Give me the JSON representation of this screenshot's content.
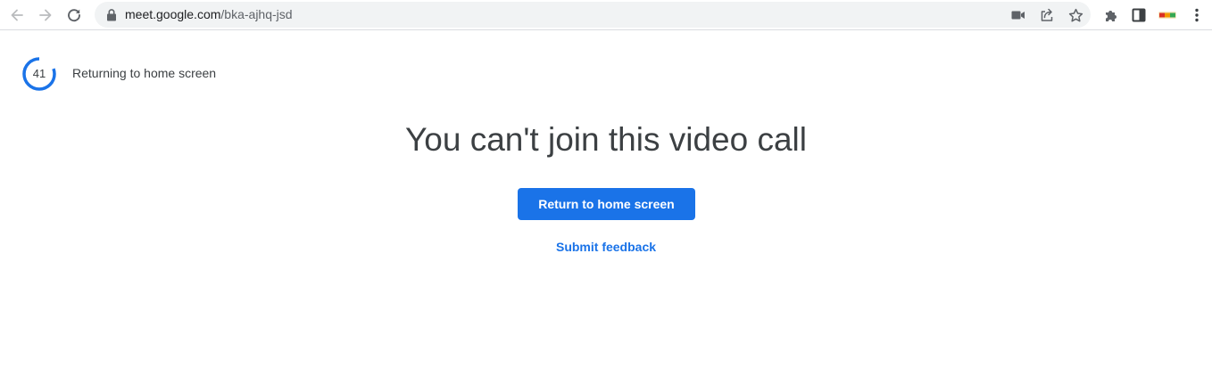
{
  "browser": {
    "url_host": "meet.google.com",
    "url_path": "/bka-ajhq-jsd",
    "icons": {
      "back": "arrow-left-icon",
      "forward": "arrow-right-icon",
      "reload": "reload-icon",
      "lock": "lock-icon",
      "camera": "camera-icon",
      "share": "share-icon",
      "bookmark": "star-icon",
      "extensions": "puzzle-icon",
      "side_panel": "side-panel-icon",
      "profile_extension": "extension-badge-icon",
      "menu": "kebab-menu-icon"
    }
  },
  "page": {
    "countdown_value": "41",
    "countdown_text": "Returning to home screen",
    "headline": "You can't join this video call",
    "primary_button": "Return to home screen",
    "feedback_link": "Submit feedback"
  },
  "colors": {
    "accent": "#1a73e8",
    "text": "#3c4043",
    "omnibox_bg": "#f1f3f4"
  }
}
